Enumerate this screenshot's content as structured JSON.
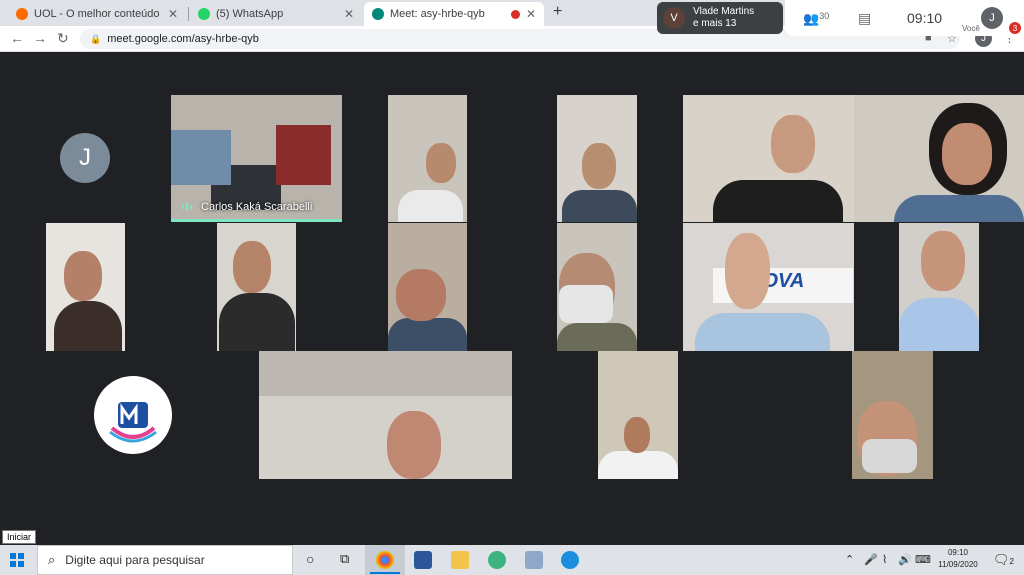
{
  "browser": {
    "tabs": [
      {
        "title": "UOL - O melhor conteúdo",
        "favicon_color": "#ff6a00"
      },
      {
        "title": "(5) WhatsApp",
        "favicon_color": "#25d366"
      },
      {
        "title": "Meet: asy-hrbe-qyb",
        "favicon_color": "#00897b",
        "recording": true
      }
    ],
    "new_tab_glyph": "+",
    "close_glyph": "✕",
    "url": "meet.google.com/asy-hrbe-qyb",
    "profile_initial": "J"
  },
  "meet": {
    "presenter_initial": "V",
    "presenter_line1": "Vlade Martins",
    "presenter_line2": "e mais 13",
    "people_count": "30",
    "time": "09:10",
    "you_label": "Você",
    "you_initial": "J",
    "notification_count": "3",
    "avatar_tile_initial": "J",
    "active_speaker_name": "Carlos Kaká Scarabelli",
    "active_color": "#7fe3c4"
  },
  "tooltip": "Iniciar",
  "taskbar": {
    "search_placeholder": "Digite aqui para pesquisar",
    "clock_time": "09:10",
    "clock_date": "11/09/2020",
    "notification_count": "2"
  }
}
